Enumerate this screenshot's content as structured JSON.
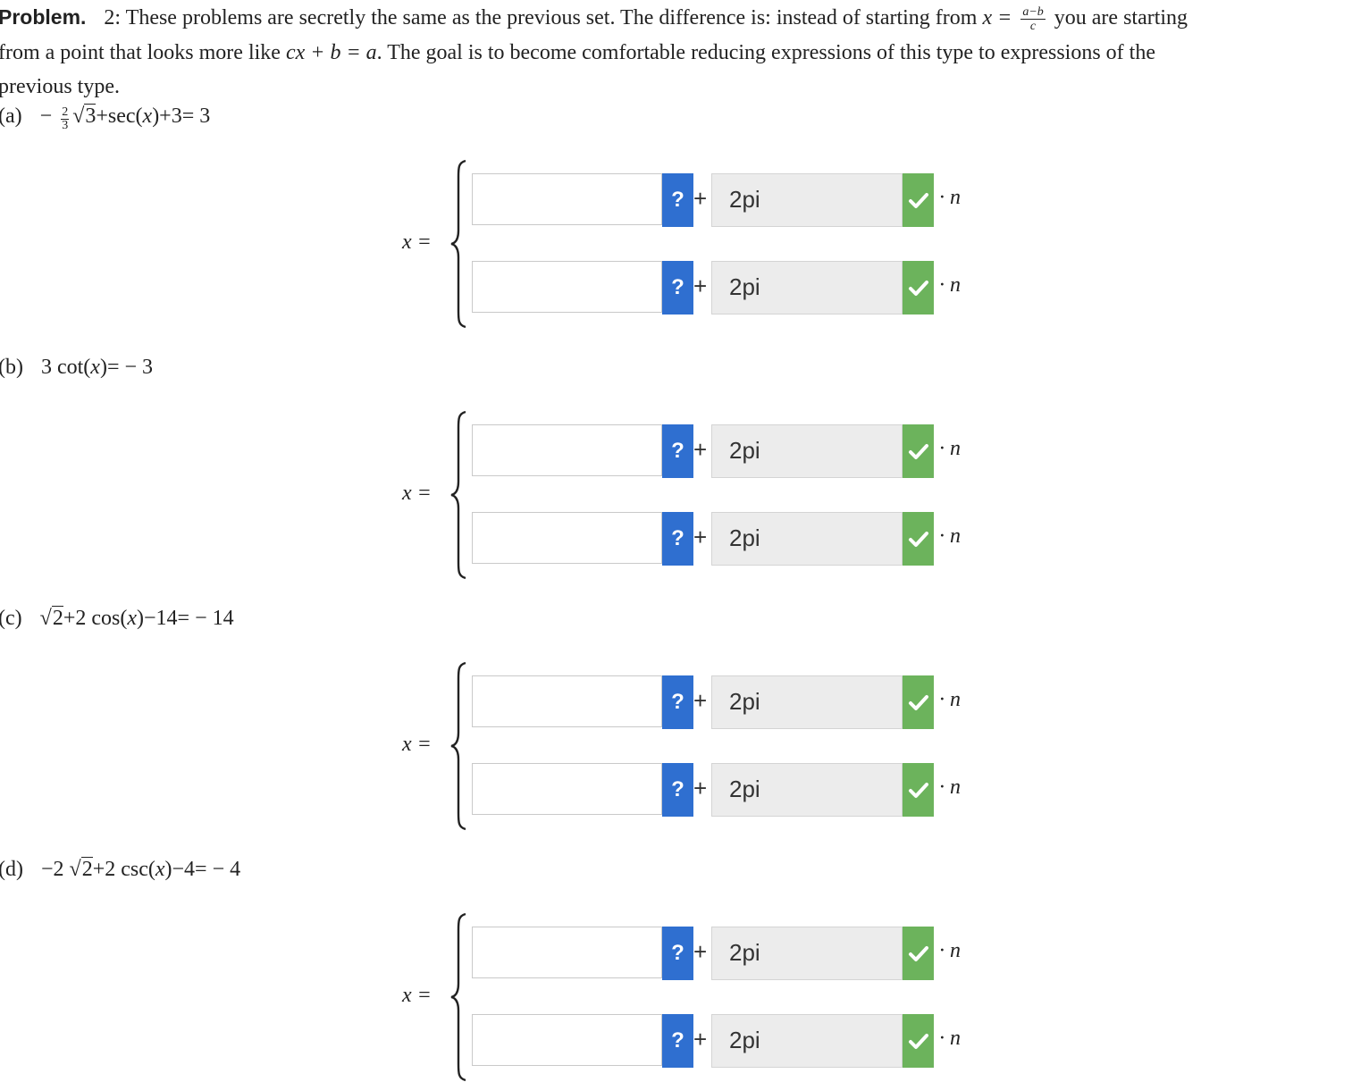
{
  "intro": {
    "label": "Problem.",
    "number": "2",
    "text_a": ": These problems are secretly the same as the previous set. The difference is: instead of starting from",
    "formula_lhs": "x =",
    "frac_num": "a−b",
    "frac_den": "c",
    "text_b": "you are starting",
    "line2_a": "from a point that looks more like",
    "line2_formula": "cx + b = a",
    "line2_b": ". The goal is to become comfortable reducing expressions of this type to expressions of the",
    "line3": "previous type."
  },
  "problems": [
    {
      "label": "(a)",
      "pre": "−",
      "coef_num": "2",
      "coef_den": "3",
      "root": "3",
      "post_a": "+sec(",
      "var": "x",
      "post_b": ")+3= 3"
    },
    {
      "label": "(b)",
      "pre": "3 cot(",
      "var": "x",
      "post": ")= − 3"
    },
    {
      "label": "(c)",
      "root": "2",
      "post_a": "+2 cos(",
      "var": "x",
      "post_b": ")−14= − 14"
    },
    {
      "label": "(d)",
      "pre": "−2 ",
      "root": "2",
      "post_a": "+2 csc(",
      "var": "x",
      "post_b": ")−4= − 4"
    }
  ],
  "answer_block": {
    "x_label": "x =",
    "help_label": "?",
    "plus": "+",
    "coef_value": "2pi",
    "dot_n": "· n",
    "input_value": ""
  },
  "colors": {
    "help_button": "#2f6fd0",
    "check_badge": "#6cb35c",
    "coef_box_bg": "#ececec"
  }
}
